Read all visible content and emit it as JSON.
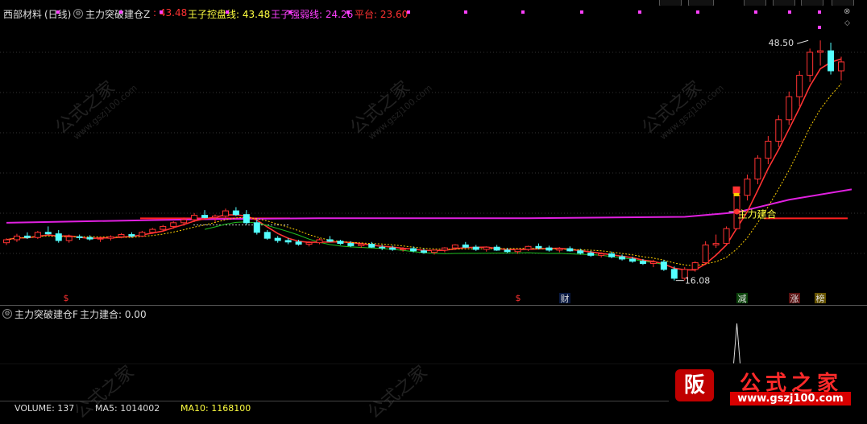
{
  "header": {
    "stock_name": "西部材料",
    "period": "(日线)",
    "indicator_name": "主力突破建仓Z",
    "main_value": ": 43.48",
    "control_label": "王子控盘线: 43.48",
    "strong_weak_label": "王子强弱线: 24.26",
    "platform_label": "平台: 23.60"
  },
  "sub_panel": {
    "indicator_name": "主力突破建仓F",
    "value_label": "主力建合: 0.00"
  },
  "volume_panel": {
    "label_volume": "VOLUME: 137",
    "label_ma5": "MA5: 1014002",
    "label_ma10": "MA10: 1168100"
  },
  "annotations": {
    "high_label": "48.50",
    "low_label": "16.08",
    "signal_label": "主力建合",
    "marker_s1": "$",
    "marker_s2": "$",
    "marker_cai": "财",
    "marker_jian": "减",
    "marker_zhang": "涨",
    "marker_bang": "榜"
  },
  "watermark": {
    "text": "公式之家",
    "url": "www.gszj100.com"
  },
  "logo": {
    "icon_char": "阪",
    "title": "公式之家",
    "url": "www.gszj100.com"
  },
  "colors": {
    "up": "#ff3232",
    "down": "#54ffff",
    "platform": "#ff2020",
    "strong_weak": "#e020e0",
    "control_line": "#ffd000",
    "green_line": "#20c020",
    "text_yellow": "#ffff40",
    "text_magenta": "#ff40ff"
  },
  "chart_data": {
    "type": "candlestick",
    "ylim": [
      14,
      52
    ],
    "candles": [
      [
        21.2,
        21.8,
        20.9,
        21.6
      ],
      [
        21.6,
        22.4,
        21.3,
        22.1
      ],
      [
        22.1,
        22.6,
        21.7,
        21.9
      ],
      [
        21.9,
        22.8,
        21.7,
        22.6
      ],
      [
        22.6,
        23.4,
        22.3,
        22.4
      ],
      [
        22.4,
        22.9,
        21.2,
        21.5
      ],
      [
        21.5,
        22.3,
        21.2,
        22.0
      ],
      [
        22.0,
        22.3,
        21.6,
        21.9
      ],
      [
        21.9,
        22.2,
        21.5,
        21.7
      ],
      [
        21.7,
        22.0,
        21.3,
        21.8
      ],
      [
        21.8,
        22.2,
        21.5,
        22.0
      ],
      [
        22.0,
        22.5,
        21.8,
        22.3
      ],
      [
        22.3,
        22.6,
        21.9,
        22.1
      ],
      [
        22.1,
        22.8,
        22.0,
        22.6
      ],
      [
        22.6,
        23.2,
        22.4,
        23.0
      ],
      [
        23.0,
        23.6,
        22.8,
        23.4
      ],
      [
        23.4,
        24.1,
        23.1,
        23.9
      ],
      [
        23.9,
        24.6,
        23.5,
        24.3
      ],
      [
        24.3,
        25.2,
        24.0,
        24.9
      ],
      [
        24.9,
        25.6,
        24.5,
        24.6
      ],
      [
        24.6,
        25.0,
        24.0,
        24.8
      ],
      [
        24.8,
        25.8,
        24.5,
        25.5
      ],
      [
        25.5,
        26.0,
        24.8,
        25.0
      ],
      [
        25.0,
        25.6,
        23.6,
        23.9
      ],
      [
        23.9,
        24.3,
        22.3,
        22.6
      ],
      [
        22.6,
        22.9,
        21.6,
        21.8
      ],
      [
        21.8,
        22.1,
        21.2,
        21.5
      ],
      [
        21.5,
        21.8,
        21.0,
        21.3
      ],
      [
        21.3,
        21.6,
        20.8,
        21.0
      ],
      [
        21.0,
        21.4,
        20.7,
        21.2
      ],
      [
        21.2,
        21.8,
        21.0,
        21.6
      ],
      [
        21.6,
        22.1,
        21.3,
        21.4
      ],
      [
        21.4,
        21.6,
        20.9,
        21.1
      ],
      [
        21.1,
        21.4,
        20.6,
        20.8
      ],
      [
        20.8,
        21.2,
        20.5,
        21.0
      ],
      [
        21.0,
        21.3,
        20.5,
        20.6
      ],
      [
        20.6,
        20.9,
        20.2,
        20.5
      ],
      [
        20.5,
        20.8,
        20.1,
        20.3
      ],
      [
        20.3,
        20.6,
        20.0,
        20.4
      ],
      [
        20.4,
        20.7,
        19.9,
        20.1
      ],
      [
        20.1,
        20.4,
        19.7,
        19.9
      ],
      [
        19.9,
        20.3,
        19.6,
        20.2
      ],
      [
        20.2,
        20.6,
        19.9,
        20.5
      ],
      [
        20.5,
        21.0,
        20.2,
        20.9
      ],
      [
        20.9,
        21.3,
        20.5,
        20.6
      ],
      [
        20.6,
        20.9,
        20.1,
        20.3
      ],
      [
        20.3,
        20.7,
        20.0,
        20.6
      ],
      [
        20.6,
        20.9,
        20.1,
        20.2
      ],
      [
        20.2,
        20.5,
        19.8,
        20.0
      ],
      [
        20.0,
        20.4,
        19.7,
        20.3
      ],
      [
        20.3,
        20.8,
        20.1,
        20.7
      ],
      [
        20.7,
        21.1,
        20.3,
        20.5
      ],
      [
        20.5,
        20.8,
        20.0,
        20.2
      ],
      [
        20.2,
        20.6,
        19.9,
        20.4
      ],
      [
        20.4,
        20.7,
        20.0,
        20.1
      ],
      [
        20.1,
        20.4,
        19.6,
        19.8
      ],
      [
        19.8,
        20.1,
        19.3,
        19.5
      ],
      [
        19.5,
        19.9,
        19.2,
        19.7
      ],
      [
        19.7,
        20.0,
        19.1,
        19.3
      ],
      [
        19.3,
        19.6,
        18.8,
        19.0
      ],
      [
        19.0,
        19.3,
        18.5,
        18.7
      ],
      [
        18.7,
        19.0,
        18.2,
        18.4
      ],
      [
        18.4,
        18.9,
        17.9,
        18.6
      ],
      [
        18.6,
        18.9,
        17.4,
        17.6
      ],
      [
        17.6,
        18.0,
        16.1,
        16.4
      ],
      [
        16.4,
        17.9,
        16.1,
        17.6
      ],
      [
        17.6,
        18.7,
        17.3,
        18.5
      ],
      [
        18.5,
        21.4,
        18.2,
        20.9
      ],
      [
        20.9,
        22.3,
        20.5,
        21.1
      ],
      [
        21.1,
        23.4,
        20.9,
        23.1
      ],
      [
        23.1,
        28.1,
        23.0,
        27.6
      ],
      [
        27.6,
        30.4,
        26.9,
        29.8
      ],
      [
        29.8,
        33.0,
        29.1,
        32.6
      ],
      [
        32.6,
        35.6,
        31.8,
        34.9
      ],
      [
        34.9,
        38.4,
        34.1,
        37.8
      ],
      [
        37.8,
        41.6,
        37.1,
        40.9
      ],
      [
        40.9,
        44.4,
        39.6,
        43.8
      ],
      [
        43.8,
        47.4,
        42.9,
        46.9
      ],
      [
        46.9,
        48.5,
        45.1,
        47.1
      ],
      [
        47.1,
        48.2,
        43.9,
        44.4
      ],
      [
        44.4,
        46.3,
        43.1,
        45.6
      ]
    ],
    "platform_upper": 24.6,
    "platform_lower": 23.6,
    "strong_weak_line": [
      {
        "x": 0,
        "y": 23.9
      },
      {
        "x": 20,
        "y": 24.4
      },
      {
        "x": 30,
        "y": 24.5
      },
      {
        "x": 50,
        "y": 24.5
      },
      {
        "x": 65,
        "y": 24.7
      },
      {
        "x": 70,
        "y": 25.3
      },
      {
        "x": 75,
        "y": 27.0
      },
      {
        "x": 81,
        "y": 28.4
      }
    ]
  }
}
